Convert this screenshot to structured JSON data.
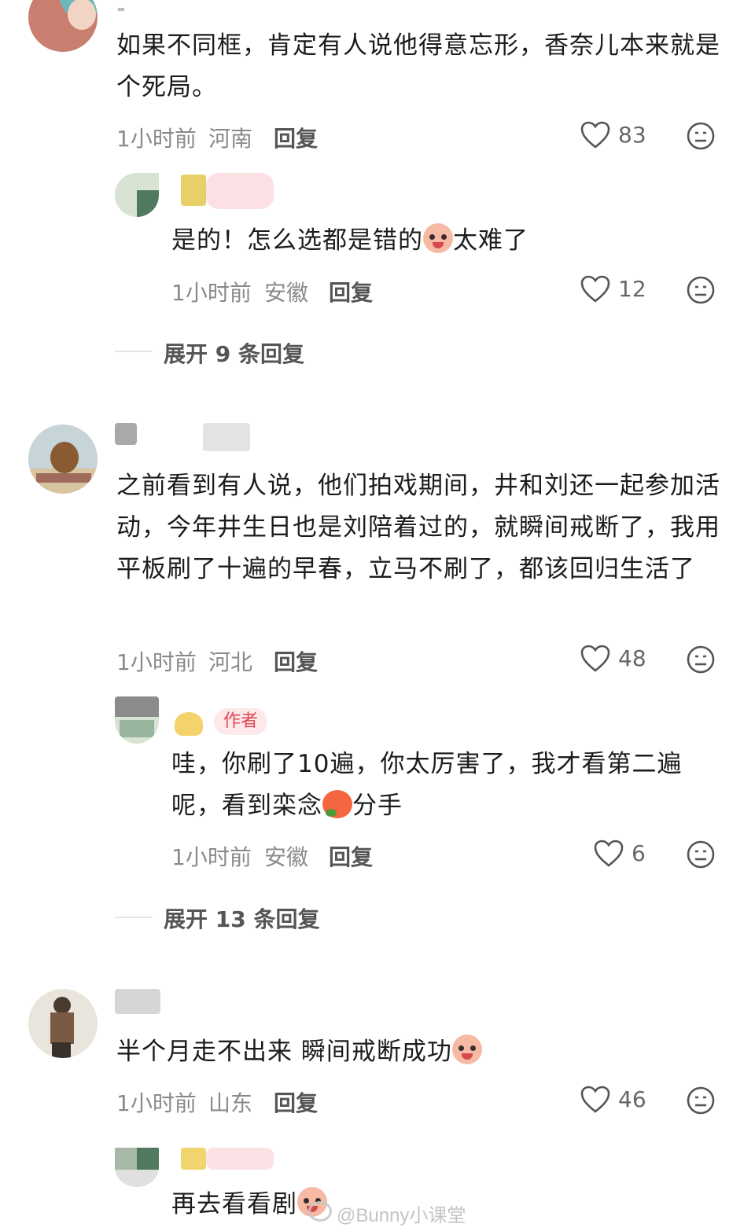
{
  "comments": [
    {
      "text": "如果不同框，肯定有人说他得意忘形，香奈儿本来就是个死局。",
      "time": "1小时前",
      "location": "河南",
      "reply_label": "回复",
      "likes": "83",
      "replies": [
        {
          "text": "是的！怎么选都是错的",
          "text_after_emoji": "太难了",
          "time": "1小时前",
          "location": "安徽",
          "reply_label": "回复",
          "likes": "12"
        }
      ],
      "expand_label": "展开 9 条回复"
    },
    {
      "text": "之前看到有人说，他们拍戏期间，井和刘还一起参加活动，今年井生日也是刘陪着过的，就瞬间戒断了，我用平板刷了十遍的早春，立马不刷了，都该回归生活了",
      "time": "1小时前",
      "location": "河北",
      "reply_label": "回复",
      "likes": "48",
      "replies": [
        {
          "badge": "作者",
          "text": "哇，你刷了10遍，你太厉害了，我才看第二遍呢，看到栾念",
          "text_after_emoji": "分手",
          "time": "1小时前",
          "location": "安徽",
          "reply_label": "回复",
          "likes": "6"
        }
      ],
      "expand_label": "展开 13 条回复"
    },
    {
      "text": "半个月走不出来 瞬间戒断成功",
      "time": "1小时前",
      "location": "山东",
      "reply_label": "回复",
      "likes": "46",
      "replies": [
        {
          "text": "再去看看剧"
        }
      ]
    }
  ],
  "watermark": "@Bunny小课堂",
  "icons": {
    "like": "heart-outline-icon",
    "dislike": "neutral-face-icon"
  }
}
